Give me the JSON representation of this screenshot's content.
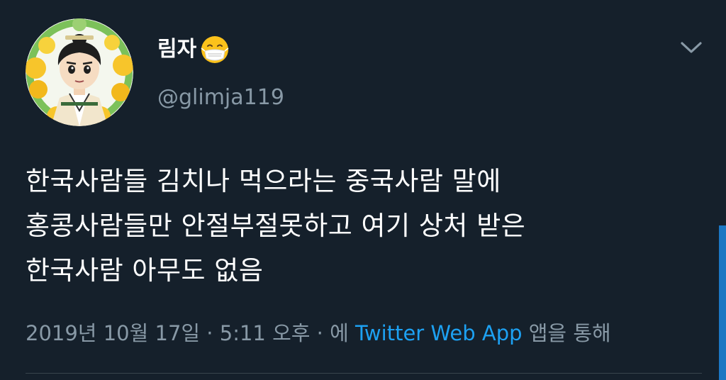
{
  "author": {
    "display_name": "림자",
    "name_emoji": "face-with-medical-mask",
    "handle": "@glimja119",
    "avatar_icon": "avatar-cartoon-scholar-lemons"
  },
  "tweet": {
    "lines": [
      "한국사람들 김치나 먹으라는 중국사람 말에",
      "홍콩사람들만 안절부절못하고 여기 상처 받은",
      "한국사람 아무도 없음"
    ]
  },
  "meta": {
    "date": "2019년 10월 17일",
    "separator1": " · ",
    "time": "5:11 오후",
    "separator2": " · ",
    "via_prefix": "에 ",
    "via_app": "Twitter Web App",
    "via_suffix": " 앱을 통해"
  },
  "icons": {
    "menu": "chevron-down-icon"
  },
  "colors": {
    "background": "#15202b",
    "text": "#ffffff",
    "secondary": "#8899a6",
    "link": "#1da1f2",
    "divider": "#38444d"
  }
}
